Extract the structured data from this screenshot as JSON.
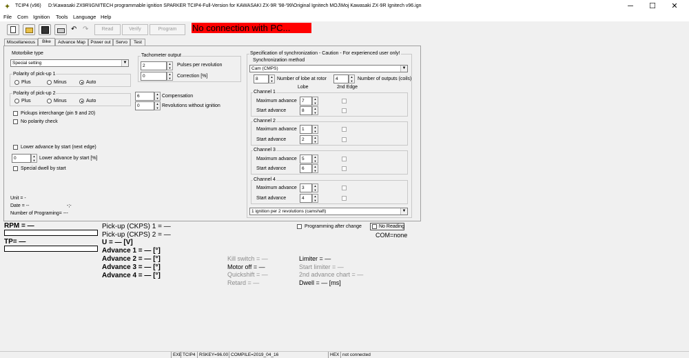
{
  "window": {
    "title": "TCIP4 (v96)",
    "path": "D:\\Kawasaki ZX9R\\IGNITECH programmable ignition SPARKER TCIP4-Full-Version for KAWASAKI ZX-9R '98-'99\\Original Ignitech MOJ\\Moj Kawasaki ZX-9R Ignitech v96.ign",
    "minimize": "─",
    "maximize": "☐",
    "close": "✕"
  },
  "menu": [
    "File",
    "Com",
    "Ignition",
    "Tools",
    "Language",
    "Help"
  ],
  "toolbar": {
    "read": "Read",
    "verify": "Verify",
    "program": "Program",
    "connection_status": "No connection with PC..."
  },
  "tabs": [
    "Miscellaneous",
    "Bike",
    "Advance Map",
    "Power out",
    "Servo",
    "Test"
  ],
  "bike": {
    "motorbike_type_label": "Motorbike type",
    "motorbike_type_value": "Special setting",
    "polarity1_label": "Polarity of pick-up 1",
    "polarity2_label": "Polarity of pick-up 2",
    "plus": "Plus",
    "minus": "Minus",
    "auto": "Auto",
    "pickups_interchange": "Pickups interchange (pin 9 and 20)",
    "no_polarity_check": "No polarity check",
    "lower_advance_start_edge": "Lower advance by start (next edge)",
    "lower_advance_value": "0",
    "lower_advance_label": "Lower advance by start [%]",
    "special_dwell": "Special dwell by start",
    "unit": "Unit = -",
    "date": "Date = --",
    "date_right": "-;-",
    "prog_num": "Number of Programing= ---"
  },
  "tacho": {
    "label": "Tachometer output",
    "pulses_value": "2",
    "pulses_label": "Pulses per revolution",
    "correction_value": "0",
    "correction_label": "Correction [%]"
  },
  "comp": {
    "value": "6",
    "label": "Compensation",
    "rev_value": "0",
    "rev_label": "Revolutions without ignition"
  },
  "sync": {
    "title": "Specification of synchronization - Caution - For experienced user only!",
    "method_label": "Synchronization method",
    "method_value": "Cam (CMPS)",
    "lobes_value": "8",
    "lobes_label": "Number of lobe at rotor",
    "outputs_value": "4",
    "outputs_label": "Number of outputs (coils)",
    "col_lobe": "Lobe",
    "col_2nd": "2nd Edge",
    "channels": [
      {
        "name": "Channel 1",
        "max_label": "Maximum advance",
        "max": "7",
        "start_label": "Start advance",
        "start": "8"
      },
      {
        "name": "Channel 2",
        "max_label": "Maximum advance",
        "max": "1",
        "start_label": "Start advance",
        "start": "2"
      },
      {
        "name": "Channel 3",
        "max_label": "Maximum advance",
        "max": "5",
        "start_label": "Start advance",
        "start": "6"
      },
      {
        "name": "Channel 4",
        "max_label": "Maximum advance",
        "max": "3",
        "start_label": "Start advance",
        "start": "4"
      }
    ],
    "ignition_mode": "1 ignition per 2 revolutions (camshaft)"
  },
  "monitor": {
    "rpm": "RPM = —",
    "tp": "TP= —",
    "ckps1": "Pick-up (CKPS) 1 = —",
    "ckps2": "Pick-up (CKPS) 2 = —",
    "voltage": "U = — [V]",
    "adv1": "Advance 1 = — [°]",
    "adv2": "Advance 2 = — [°]",
    "adv3": "Advance 3 = — [°]",
    "adv4": "Advance 4 = — [°]",
    "kill": "Kill switch = —",
    "motor_off": "Motor off = —",
    "quickshift": "Quickshift = —",
    "retard": "Retard = —",
    "limiter": "Limiter = —",
    "start_limiter": "Start limiter = —",
    "second_chart": "2nd advance chart = —",
    "dwell": "Dwell = — [ms]",
    "prog_after_change": "Programming after change",
    "no_reading": "No Reading",
    "com": "COM=none"
  },
  "statusbar": {
    "exe": "EXE",
    "tcip": "TCIP4",
    "rskey": "RSKEY=96.00",
    "compile": "COMPILE=2019_04_16",
    "hex": "HEX",
    "conn": "not connected"
  },
  "colors": {
    "alert_bg": "#ff0000",
    "window_bg": "#f0f0f0"
  }
}
